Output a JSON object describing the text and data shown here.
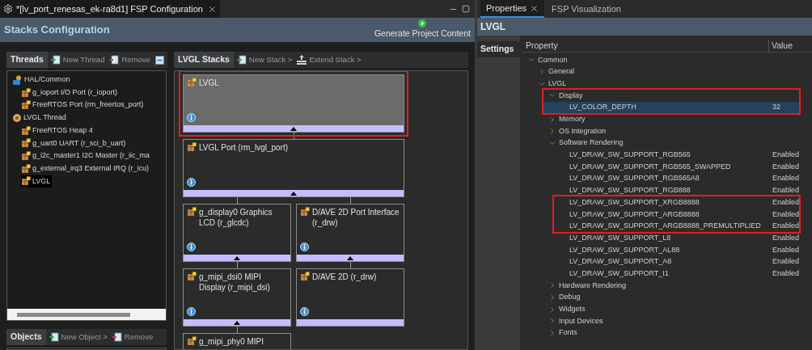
{
  "editor": {
    "tab": {
      "title": "*[lv_port_renesas_ek-ra8d1] FSP Configuration",
      "selected": true
    },
    "header": "Stacks Configuration",
    "generate_button": "Generate Project Content"
  },
  "threads": {
    "title": "Threads",
    "toolbar": [
      {
        "label": "New Thread",
        "kind": "new"
      },
      {
        "label": "Remove",
        "kind": "remove"
      }
    ],
    "tree": [
      {
        "label": "HAL/Common",
        "kind": "hal",
        "selected": false,
        "children": [
          {
            "label": "g_ioport I/O Port (r_ioport)",
            "kind": "module",
            "selected": false
          },
          {
            "label": "FreeRTOS Port (rm_freertos_port)",
            "kind": "module",
            "selected": false
          }
        ]
      },
      {
        "label": "LVGL Thread",
        "kind": "thread",
        "selected": false,
        "children": [
          {
            "label": "FreeRTOS Heap 4",
            "kind": "module",
            "selected": false
          },
          {
            "label": "g_uart0 UART (r_sci_b_uart)",
            "kind": "module",
            "selected": false
          },
          {
            "label": "g_i2c_master1 I2C Master (r_iic_ma",
            "kind": "module",
            "selected": false
          },
          {
            "label": "g_external_irq3 External IRQ (r_icu)",
            "kind": "module",
            "selected": false
          },
          {
            "label": "LVGL",
            "kind": "module",
            "selected": true
          }
        ]
      }
    ]
  },
  "objects": {
    "title": "Objects",
    "toolbar": [
      {
        "label": "New Object >",
        "kind": "new"
      },
      {
        "label": "Remove",
        "kind": "remove"
      }
    ]
  },
  "stacks": {
    "title": "LVGL Stacks",
    "toolbar": [
      {
        "label": "New Stack >",
        "kind": "new"
      },
      {
        "label": "Extend Stack >",
        "kind": "extend"
      }
    ],
    "root": {
      "label": "LVGL",
      "selected": true,
      "highlighted": true,
      "children": [
        {
          "label": "LVGL Port (rm_lvgl_port)",
          "selected": false,
          "highlighted": false,
          "children": [
            {
              "label": "g_display0 Graphics LCD (r_glcdc)",
              "selected": false,
              "highlighted": false,
              "children": [
                {
                  "label": "g_mipi_dsi0 MIPI Display (r_mipi_dsi)",
                  "selected": false,
                  "highlighted": false,
                  "children": [
                    {
                      "label": "g_mipi_phy0 MIPI",
                      "selected": false,
                      "highlighted": false
                    }
                  ]
                }
              ]
            },
            {
              "label": "D/AVE 2D Port Interface (r_drw)",
              "selected": false,
              "highlighted": false,
              "children": [
                {
                  "label": "D/AVE 2D (r_drw)",
                  "selected": false,
                  "highlighted": false
                }
              ]
            }
          ]
        }
      ]
    }
  },
  "properties": {
    "tabs": [
      {
        "label": "Properties",
        "selected": true,
        "closable": true
      },
      {
        "label": "FSP Visualization",
        "selected": false,
        "closable": false
      }
    ],
    "title": "LVGL",
    "sidebar": [
      {
        "label": "Settings",
        "selected": true
      }
    ],
    "columns": [
      "Property",
      "Value"
    ],
    "rows": [
      {
        "label": "Common",
        "expanded": true,
        "highlighted": false,
        "children": [
          {
            "label": "General",
            "expanded": false,
            "highlighted": false
          },
          {
            "label": "LVGL",
            "expanded": true,
            "highlighted": false,
            "children": [
              {
                "label": "Display",
                "expanded": true,
                "highlighted": true,
                "children": [
                  {
                    "label": "LV_COLOR_DEPTH",
                    "value": "32",
                    "selected": true,
                    "highlighted": true
                  }
                ]
              },
              {
                "label": "Memory",
                "expanded": false,
                "highlighted": false
              },
              {
                "label": "OS Integration",
                "expanded": false,
                "highlighted": false
              },
              {
                "label": "Software Rendering",
                "expanded": true,
                "highlighted": false,
                "children": [
                  {
                    "label": "LV_DRAW_SW_SUPPORT_RGB565",
                    "value": "Enabled",
                    "selected": false,
                    "highlighted": false
                  },
                  {
                    "label": "LV_DRAW_SW_SUPPORT_RGB565_SWAPPED",
                    "value": "Enabled",
                    "selected": false,
                    "highlighted": false
                  },
                  {
                    "label": "LV_DRAW_SW_SUPPORT_RGB565A8",
                    "value": "Enabled",
                    "selected": false,
                    "highlighted": false
                  },
                  {
                    "label": "LV_DRAW_SW_SUPPORT_RGB888",
                    "value": "Enabled",
                    "selected": false,
                    "highlighted": false
                  },
                  {
                    "label": "LV_DRAW_SW_SUPPORT_XRGB8888",
                    "value": "Enabled",
                    "selected": false,
                    "highlighted": true
                  },
                  {
                    "label": "LV_DRAW_SW_SUPPORT_ARGB8888",
                    "value": "Enabled",
                    "selected": false,
                    "highlighted": true
                  },
                  {
                    "label": "LV_DRAW_SW_SUPPORT_ARGB8888_PREMULTIPLIED",
                    "value": "Enabled",
                    "selected": false,
                    "highlighted": true
                  },
                  {
                    "label": "LV_DRAW_SW_SUPPORT_L8",
                    "value": "Enabled",
                    "selected": false,
                    "highlighted": false
                  },
                  {
                    "label": "LV_DRAW_SW_SUPPORT_AL88",
                    "value": "Enabled",
                    "selected": false,
                    "highlighted": false
                  },
                  {
                    "label": "LV_DRAW_SW_SUPPORT_A8",
                    "value": "Enabled",
                    "selected": false,
                    "highlighted": false
                  },
                  {
                    "label": "LV_DRAW_SW_SUPPORT_I1",
                    "value": "Enabled",
                    "selected": false,
                    "highlighted": false
                  }
                ]
              },
              {
                "label": "Hardware Rendering",
                "expanded": false,
                "highlighted": false
              },
              {
                "label": "Debug",
                "expanded": false,
                "highlighted": false
              },
              {
                "label": "Widgets",
                "expanded": false,
                "highlighted": false
              },
              {
                "label": "Input Devices",
                "expanded": false,
                "highlighted": false
              },
              {
                "label": "Fonts",
                "expanded": false,
                "highlighted": false
              }
            ]
          }
        ]
      }
    ]
  }
}
